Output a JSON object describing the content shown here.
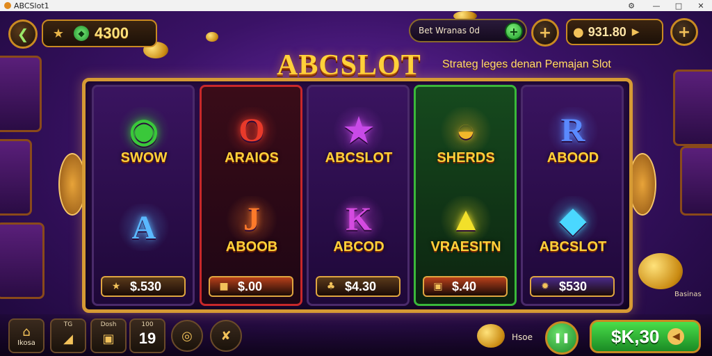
{
  "window": {
    "title": "ABCSlot1",
    "controls": [
      "—",
      "□",
      "✕"
    ],
    "settings_icon": "gamepad-icon"
  },
  "topbar": {
    "back_icon": "❮",
    "balance_icon": "★",
    "gem_icon": "◆",
    "balance": "4300",
    "bet_label": "Bet Wranas 0d",
    "bet_plus": "+",
    "add_label": "+",
    "coins_icon": "●",
    "coins": "931.80",
    "coins_arrow": "▶",
    "menu_label": "+"
  },
  "logo": {
    "title": "ABCSLOT",
    "subtitle": "Strateg leges denan Pemajan Slot"
  },
  "reels": [
    {
      "variant": "purple",
      "top_symbol": {
        "glyph": "◉",
        "label": "SWOW",
        "color": "#3ac83a"
      },
      "bottom_symbol": {
        "glyph": "A",
        "label": "",
        "color": "#5ab8ff"
      },
      "price_icon": "★",
      "price": "$.530",
      "pill_color": "#5a3a1a"
    },
    {
      "variant": "red",
      "top_symbol": {
        "glyph": "O",
        "label": "ARAIOS",
        "color": "#e83a2a"
      },
      "bottom_symbol": {
        "glyph": "J",
        "label": "ABOOB",
        "color": "#ff7a2a"
      },
      "price_icon": "■",
      "price": "$.00",
      "pill_color": "#b8401a"
    },
    {
      "variant": "purple",
      "top_symbol": {
        "glyph": "★",
        "label": "ABCSLOT",
        "color": "#c84ae8"
      },
      "bottom_symbol": {
        "glyph": "K",
        "label": "ABCOD",
        "color": "#d44ae0"
      },
      "price_icon": "♣",
      "price": "$4.30",
      "pill_color": "#5a3a1a"
    },
    {
      "variant": "green",
      "top_symbol": {
        "glyph": "◒",
        "label": "SHERDS",
        "color": "#f2b82a"
      },
      "bottom_symbol": {
        "glyph": "▲",
        "label": "VRAESITN",
        "color": "#f2e02a"
      },
      "price_icon": "▣",
      "price": "$.40",
      "pill_color": "#b8401a"
    },
    {
      "variant": "purple",
      "top_symbol": {
        "glyph": "R",
        "label": "ABOOD",
        "color": "#5a8aff"
      },
      "bottom_symbol": {
        "glyph": "◆",
        "label": "ABCSLOT",
        "color": "#4ad8ff"
      },
      "price_icon": "✹",
      "price": "$530",
      "pill_color": "#4a2a8a"
    }
  ],
  "bottom": {
    "nav": [
      {
        "top": "",
        "icon": "⌂",
        "label": "Ikosa"
      },
      {
        "top": "TG",
        "icon": "◢",
        "label": ""
      },
      {
        "top": "Dosh",
        "icon": "▣",
        "label": ""
      },
      {
        "top": "100",
        "icon": "",
        "label": "",
        "big": "19"
      },
      {
        "top": "",
        "icon": "◎",
        "label": ""
      },
      {
        "top": "",
        "icon": "✘",
        "label": ""
      }
    ],
    "mode_label": "Hsoe",
    "pause_icon": "❚❚",
    "spin_value": "$K,30",
    "spin_arrow": "◀",
    "side_caption": "Basinas"
  }
}
